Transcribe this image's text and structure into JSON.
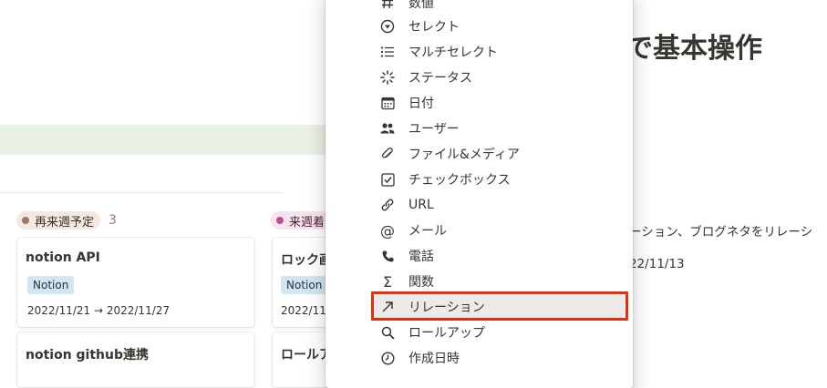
{
  "heading": "で基本操作",
  "body_text": "ーション、ブログネタをリレーシ",
  "date_text": "22/11/13",
  "board": {
    "columns": [
      {
        "label": "再来週予定",
        "count": "3",
        "cards": [
          {
            "title": "notion API",
            "tag": "Notion",
            "date": "2022/11/21 → 2022/11/27"
          },
          {
            "title": "notion github連携"
          }
        ]
      },
      {
        "label": "来週着",
        "cards": [
          {
            "title": "ロック画",
            "tag": "Notion",
            "date": "2022/11"
          },
          {
            "title": "ロールア"
          }
        ]
      }
    ]
  },
  "property_menu": {
    "items": [
      {
        "label": "数値",
        "icon": "number-icon"
      },
      {
        "label": "セレクト",
        "icon": "select-icon"
      },
      {
        "label": "マルチセレクト",
        "icon": "multi-select-icon"
      },
      {
        "label": "ステータス",
        "icon": "status-icon"
      },
      {
        "label": "日付",
        "icon": "calendar-icon"
      },
      {
        "label": "ユーザー",
        "icon": "people-icon"
      },
      {
        "label": "ファイル&メディア",
        "icon": "paperclip-icon"
      },
      {
        "label": "チェックボックス",
        "icon": "checkbox-icon"
      },
      {
        "label": "URL",
        "icon": "link-icon"
      },
      {
        "label": "メール",
        "icon": "at-icon"
      },
      {
        "label": "電話",
        "icon": "phone-icon"
      },
      {
        "label": "関数",
        "icon": "sigma-icon"
      },
      {
        "label": "リレーション",
        "icon": "arrow-up-right-icon",
        "highlighted": true
      },
      {
        "label": "ロールアップ",
        "icon": "search-icon"
      },
      {
        "label": "作成日時",
        "icon": "clock-icon"
      }
    ]
  },
  "colors": {
    "highlight_border": "#ee2a10",
    "tag_bg": "#d3e5ef",
    "pill_brown_bg": "#f4e8e2",
    "pill_pink_bg": "#f7e3ee"
  }
}
